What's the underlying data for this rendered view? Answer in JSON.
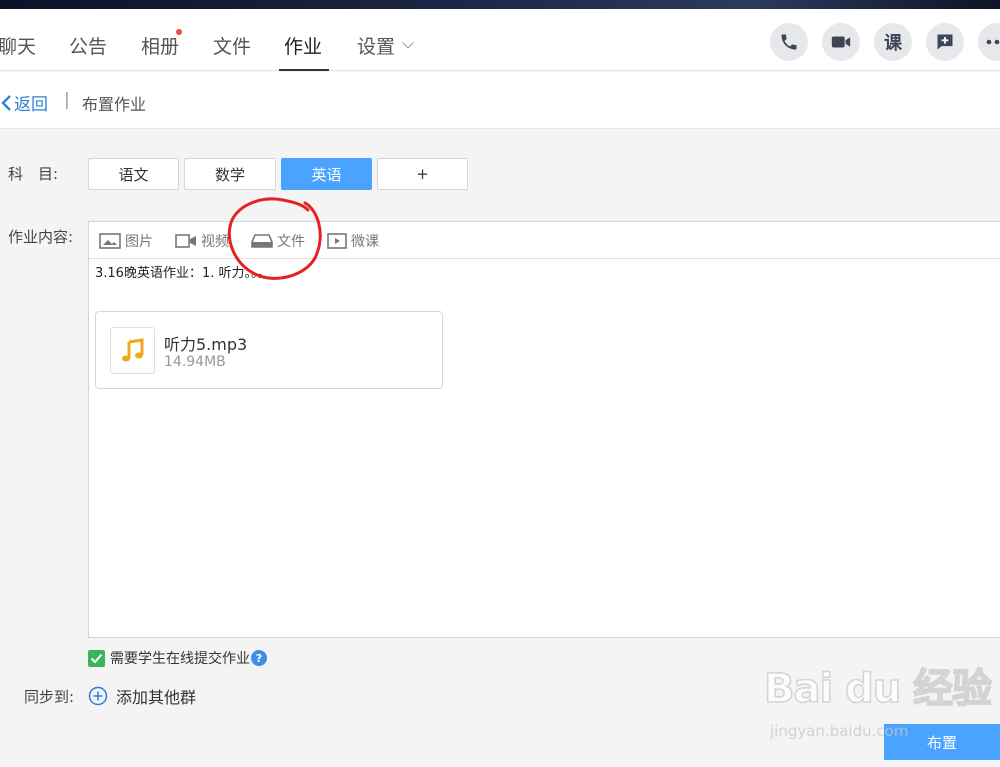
{
  "tabs": [
    {
      "label": "聊天"
    },
    {
      "label": "公告"
    },
    {
      "label": "相册"
    },
    {
      "label": "文件"
    },
    {
      "label": "作业"
    },
    {
      "label": "设置"
    }
  ],
  "active_tab": "作业",
  "action_icons": [
    "phone-icon",
    "video-call-icon",
    "lesson-icon",
    "add-message-icon",
    "more-icon"
  ],
  "lesson_button_label": "课",
  "subheader": {
    "back_label": "返回",
    "separator": "|",
    "breadcrumb": "布置作业"
  },
  "form": {
    "subject_label": "科　目:",
    "subjects": [
      "语文",
      "数学",
      "英语",
      "+"
    ],
    "selected_subject": "英语",
    "content_label": "作业内容:",
    "toolbar": [
      {
        "label": "图片",
        "icon": "image-icon"
      },
      {
        "label": "视频",
        "icon": "video-icon"
      },
      {
        "label": "文件",
        "icon": "file-icon"
      },
      {
        "label": "微课",
        "icon": "micro-lesson-icon"
      }
    ],
    "content_text": "3.16晚英语作业：1. 听力。。。",
    "attachment": {
      "name": "听力5.mp3",
      "size": "14.94MB",
      "icon": "music-note-icon"
    },
    "require_online_label": "需要学生在线提交作业",
    "require_online_checked": true,
    "sync_label": "同步到:",
    "add_group_label": "添加其他群",
    "submit_label": "布置"
  },
  "watermark": {
    "main": "Bai du 经验",
    "sub": "jingyan.baidu.com"
  },
  "colors": {
    "accent": "#4aa4ff",
    "link": "#2f7fd8",
    "check": "#3db35a",
    "annotation": "#e52222",
    "notification_dot": "#f04848"
  }
}
